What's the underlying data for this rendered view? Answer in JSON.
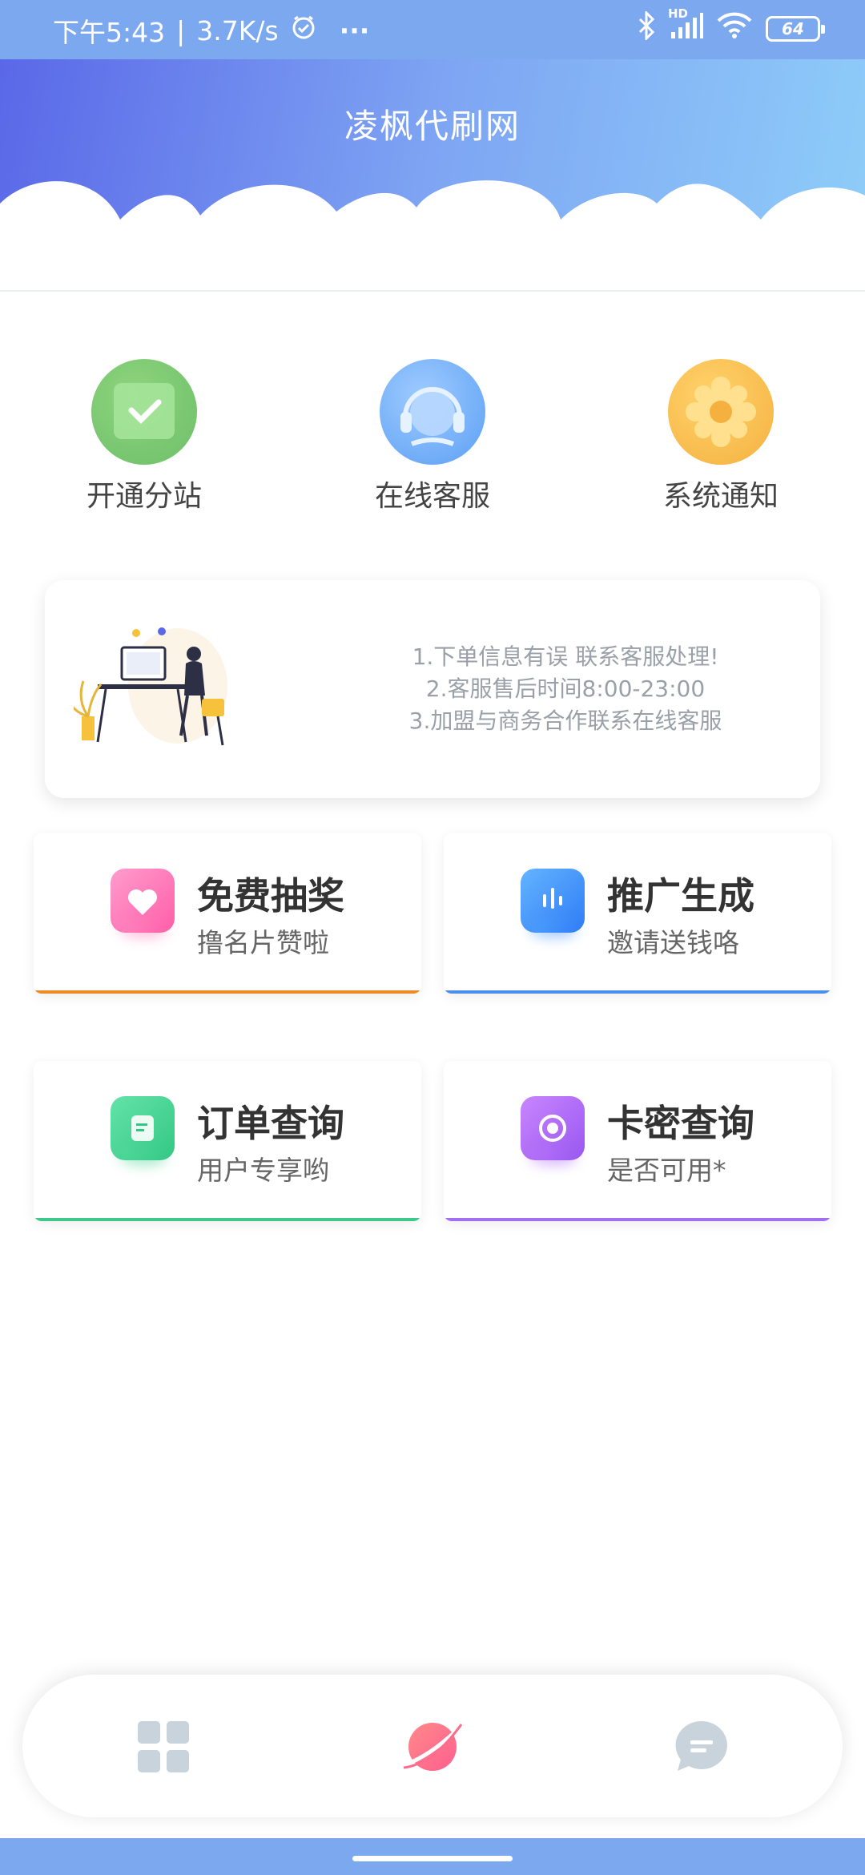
{
  "status_bar": {
    "time": "下午5:43",
    "speed": "3.7K/s",
    "dots": "···",
    "network": "HD",
    "battery": "64"
  },
  "header": {
    "title": "凌枫代刷网"
  },
  "quick_actions": [
    {
      "label": "开通分站",
      "icon": "check-icon"
    },
    {
      "label": "在线客服",
      "icon": "headset-icon"
    },
    {
      "label": "系统通知",
      "icon": "gear-icon"
    }
  ],
  "notice": {
    "lines": [
      "1.下单信息有误 联系客服处理!",
      "2.客服售后时间8:00-23:00",
      "3.加盟与商务合作联系在线客服"
    ]
  },
  "features": [
    {
      "title": "免费抽奖",
      "subtitle": "撸名片赞啦",
      "icon": "heart-icon",
      "accent": "#f08a24"
    },
    {
      "title": "推广生成",
      "subtitle": "邀请送钱咯",
      "icon": "voice-icon",
      "accent": "#4a8ff0"
    },
    {
      "title": "订单查询",
      "subtitle": "用户专享哟",
      "icon": "note-icon",
      "accent": "#3cc98a"
    },
    {
      "title": "卡密查询",
      "subtitle": "是否可用*",
      "icon": "record-icon",
      "accent": "#a26ff0"
    }
  ],
  "bottom_nav": [
    {
      "icon": "grid-icon"
    },
    {
      "icon": "planet-icon"
    },
    {
      "icon": "chat-icon"
    }
  ],
  "colors": {
    "status_bar": "#7ba8ef",
    "header_start": "#5a68e8",
    "header_end": "#8ecdf9"
  }
}
